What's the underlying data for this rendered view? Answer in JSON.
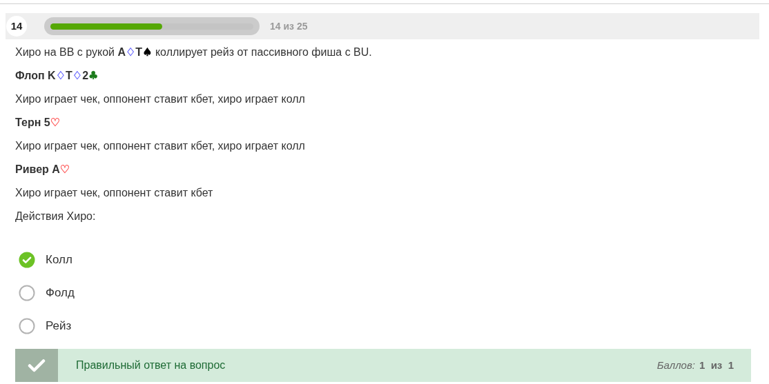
{
  "header": {
    "number": "14",
    "progress": {
      "level": 0.55
    },
    "counter": "14 из 25"
  },
  "question": [
    [
      {
        "text": "Хиро на BB с рукой "
      },
      {
        "text": "A",
        "bold": true
      },
      {
        "text": "♢",
        "color": "#6b6bff"
      },
      {
        "text": "T",
        "bold": true
      },
      {
        "text": "♠",
        "color": "#000000"
      },
      {
        "text": " коллирует рейз от пассивного фиша с BU."
      }
    ],
    [
      {
        "text": "Флоп K",
        "bold": true
      },
      {
        "text": "♢",
        "color": "#6b6bff"
      },
      {
        "text": "T",
        "bold": true
      },
      {
        "text": "♢",
        "color": "#6b6bff"
      },
      {
        "text": "2",
        "bold": true
      },
      {
        "text": "♣",
        "color": "#1a7a1a"
      }
    ],
    [
      {
        "text": "Хиро играет чек, оппонент ставит кбет, хиро играет колл"
      }
    ],
    [
      {
        "text": "Терн 5",
        "bold": true
      },
      {
        "text": "♡",
        "color": "#ff5c5c"
      }
    ],
    [
      {
        "text": "Хиро играет чек, оппонент ставит кбет, хиро играет колл"
      }
    ],
    [
      {
        "text": "Ривер A",
        "bold": true
      },
      {
        "text": "♡",
        "color": "#ff5c5c"
      }
    ],
    [
      {
        "text": "Хиро играет чек, оппонент ставит кбет"
      }
    ],
    [
      {
        "text": "Действия Хиро:"
      }
    ]
  ],
  "options": [
    {
      "label": "Колл",
      "selected": true
    },
    {
      "label": "Фолд",
      "selected": false
    },
    {
      "label": "Рейз",
      "selected": false
    }
  ],
  "result": {
    "correct": true,
    "message": "Правильный ответ на вопрос",
    "score_label": "Баллов:",
    "score": "1",
    "of": "из",
    "max": "1"
  }
}
